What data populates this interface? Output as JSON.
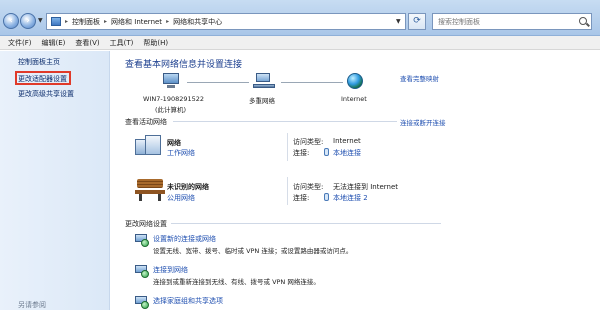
{
  "address_bar": {
    "crumbs": [
      "控制面板",
      "网络和 Internet",
      "网络和共享中心"
    ],
    "search_placeholder": "搜索控制面板"
  },
  "menu": [
    "文件(F)",
    "编辑(E)",
    "查看(V)",
    "工具(T)",
    "帮助(H)"
  ],
  "sidebar": {
    "home": "控制面板主页",
    "adapter_settings": "更改适配器设置",
    "advanced_sharing": "更改高级共享设置",
    "see_also": "另请参阅"
  },
  "main": {
    "title": "查看基本网络信息并设置连接",
    "view_full_map": "查看完整映射",
    "map": {
      "computer_name": "WIN7-1908291522",
      "computer_note": "(此计算机)",
      "network": "多重网络",
      "internet": "Internet"
    },
    "active_networks_heading": "查看活动网络",
    "connect_disconnect": "连接或断开连接",
    "networks": [
      {
        "name": "网络",
        "type": "工作网络",
        "access_key": "访问类型:",
        "access_val": "Internet",
        "conn_key": "连接:",
        "conn_val": "本地连接"
      },
      {
        "name": "未识别的网络",
        "type": "公用网络",
        "access_key": "访问类型:",
        "access_val": "无法连接到 Internet",
        "conn_key": "连接:",
        "conn_val": "本地连接 2"
      }
    ],
    "change_settings_heading": "更改网络设置",
    "tasks": [
      {
        "title": "设置新的连接或网络",
        "desc": "设置无线、宽带、拨号、临时或 VPN 连接；或设置路由器或访问点。"
      },
      {
        "title": "连接到网络",
        "desc": "连接到或重新连接到无线、有线、拨号或 VPN 网络连接。"
      },
      {
        "title": "选择家庭组和共享选项",
        "desc": ""
      }
    ]
  }
}
